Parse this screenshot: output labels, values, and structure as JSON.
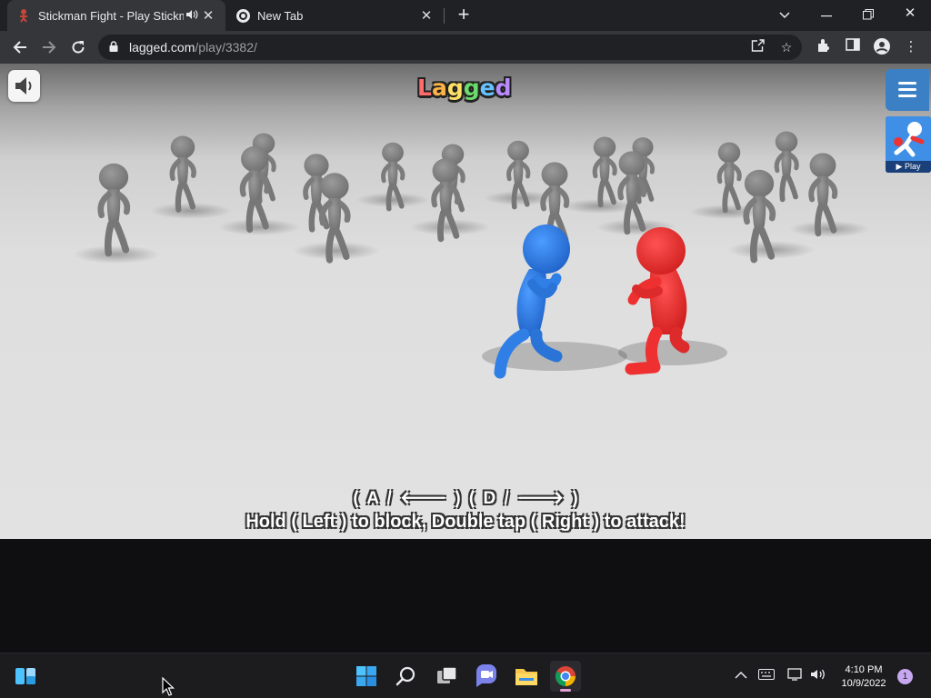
{
  "tabs": [
    {
      "title": "Stickman Fight - Play Stickma",
      "active": true,
      "audible": true
    },
    {
      "title": "New Tab",
      "active": false
    }
  ],
  "toolbar": {
    "url_host": "lagged.com",
    "url_path": "/play/3382/"
  },
  "game": {
    "logo": "Lagged",
    "promo_label": "▶ Play",
    "controls_line": "( A / 🡐 )    ( D / 🡒 )",
    "instruction": "Hold ( Left ) to block, Double tap ( Right ) to attack!",
    "colors": {
      "blue_fighter": "#2f7fe6",
      "red_fighter": "#ee3030",
      "crowd": "#8a8a8a",
      "menu": "#3b7fc4"
    }
  },
  "taskbar": {
    "time": "4:10 PM",
    "date": "10/9/2022",
    "notification_count": "1",
    "icons": [
      "widgets-icon",
      "start-icon",
      "search-icon",
      "task-view-icon",
      "chat-icon",
      "file-explorer-icon",
      "chrome-icon"
    ]
  }
}
